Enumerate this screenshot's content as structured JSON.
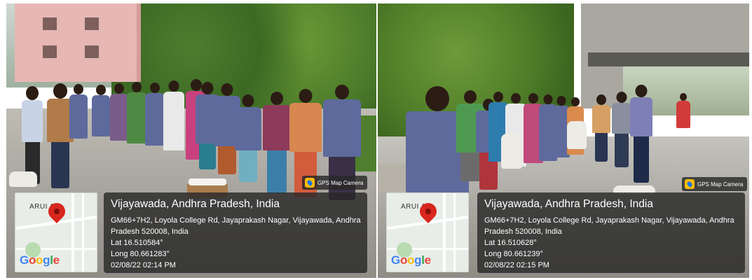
{
  "photos": [
    {
      "map": {
        "place_label": "ARUI  AR",
        "logo": "Google"
      },
      "badge": "GPS Map Camera",
      "title": "Vijayawada, Andhra Pradesh, India",
      "address_line1": "GM66+7H2, Loyola College Rd, Jayaprakash Nagar, Vijayawada, Andhra",
      "address_line2": "Pradesh 520008, India",
      "lat": "Lat 16.510584°",
      "long": "Long 80.661283°",
      "datetime": "02/08/22 02:14 PM"
    },
    {
      "map": {
        "place_label": "ARUI  AR",
        "logo": "Google"
      },
      "badge": "GPS Map Camera",
      "title": "Vijayawada, Andhra Pradesh, India",
      "address_line1": "GM66+7H2, Loyola College Rd, Jayaprakash Nagar, Vijayawada, Andhra",
      "address_line2": "Pradesh 520008, India",
      "lat": "Lat 16.510628°",
      "long": "Long 80.661239°",
      "datetime": "02/08/22 02:15 PM"
    }
  ],
  "colors": {
    "uniform": "#5e6a9c",
    "overlay_bg": "#282828",
    "pin": "#d8261e"
  }
}
